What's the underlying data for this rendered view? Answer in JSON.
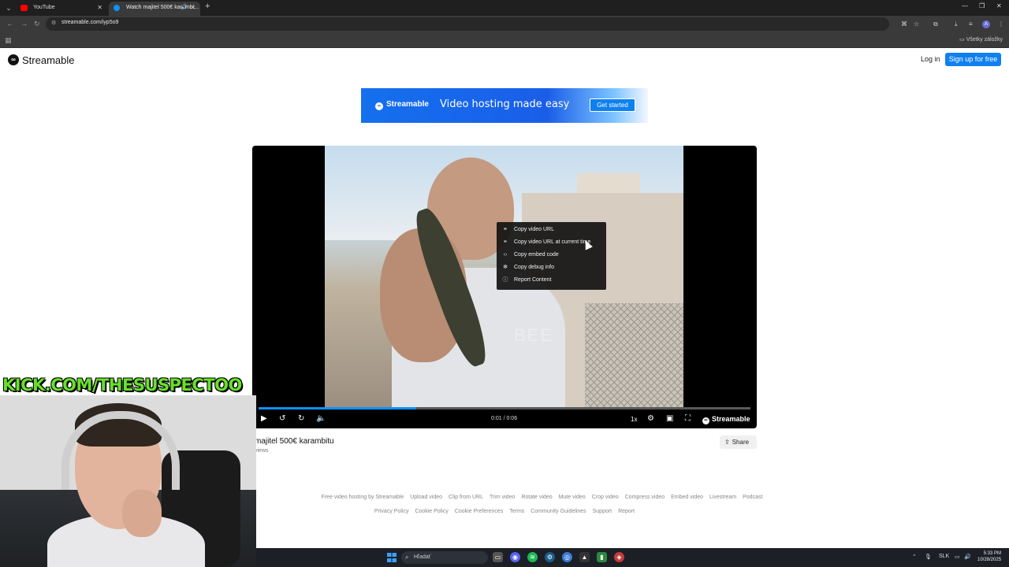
{
  "browser": {
    "tabs": [
      {
        "title": "YouTube"
      },
      {
        "title": "Watch majitel 500€ karambi..."
      }
    ],
    "url": "streamable.com/iyp5o9",
    "avatar_letter": "A",
    "bookmarks_label": "Všetky záložky"
  },
  "site": {
    "logo_text": "Streamable",
    "login_label": "Log in",
    "signup_label": "Sign up for free"
  },
  "banner": {
    "logo_text": "Streamable",
    "tagline": "Video hosting made easy",
    "cta_label": "Get started"
  },
  "player": {
    "context_menu": [
      {
        "icon": "link-icon",
        "label": "Copy video URL"
      },
      {
        "icon": "link-icon",
        "label": "Copy video URL at current time"
      },
      {
        "icon": "code-icon",
        "label": "Copy embed code"
      },
      {
        "icon": "bug-icon",
        "label": "Copy debug info"
      },
      {
        "icon": "info-icon",
        "label": "Report Content"
      }
    ],
    "watermark": "BEE",
    "time": "0:01 / 0:06",
    "progress_fraction": 0.32,
    "buffered_fraction": 0.32,
    "speed": "1x",
    "brand": "Streamable"
  },
  "video": {
    "title": "majitel 500€ karambitu",
    "views": "views",
    "share_label": "Share"
  },
  "footer": {
    "row1": [
      "Free video hosting by Streamable",
      "Upload video",
      "Clip from URL",
      "Trim video",
      "Rotate video",
      "Mute video",
      "Crop video",
      "Compress video",
      "Embed video",
      "Livestream",
      "Podcast"
    ],
    "row2": [
      "Privacy Policy",
      "Cookie Policy",
      "Cookie Preferences",
      "Terms",
      "Community Guidelines",
      "Support",
      "Report"
    ]
  },
  "overlay": {
    "kick_text": "KICK.COM/THESUSPECTOO"
  },
  "taskbar": {
    "search_placeholder": "Hľadať",
    "lang": "SLK",
    "time": "5:33 PM",
    "date": "10/28/2025"
  },
  "colors": {
    "accent": "#0f80f0",
    "kick_green": "#66e12a",
    "progress": "#0f90fa"
  }
}
